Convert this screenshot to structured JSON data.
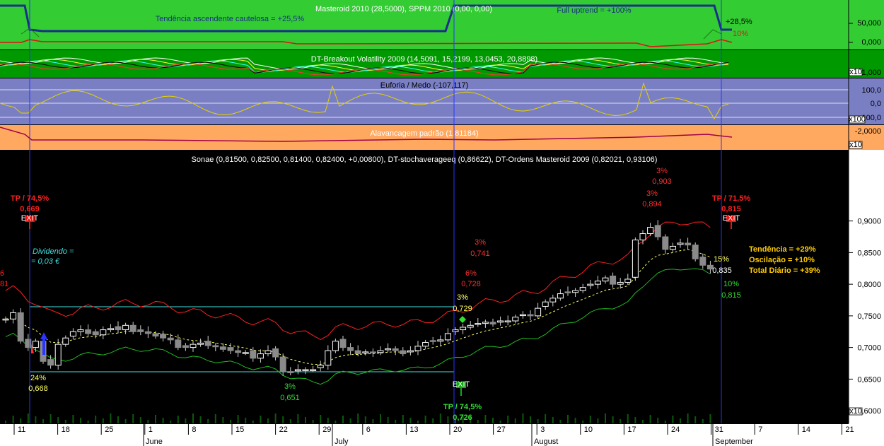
{
  "panels": {
    "p1": {
      "title": "Masteroid 2010 (28,5000), SPPM 2010 (0,00, 0,00)",
      "left_note": "Tendência ascendente cautelosa = +25,5%",
      "right_note": "Full uptrend = +100%",
      "end_label_1": "+28,5%",
      "end_label_2": "10%",
      "ticks": [
        "50,000",
        "0,000"
      ],
      "colors": {
        "bg": "#33cc33",
        "main": "#1a2e8a",
        "red": "#e01010"
      }
    },
    "p2": {
      "title": "DT-Breakout Volatility 2009 (14,5091, 15,2199, 13,0453, 20,8898)",
      "ticks": [
        "1,000"
      ],
      "scale_tag": "x10",
      "colors": {
        "bg": "#009900"
      }
    },
    "p3": {
      "title": "Euforia / Medo (-107,117)",
      "ticks": [
        "100,0",
        "0,0",
        "-100,0"
      ],
      "scale_tag": "x100",
      "colors": {
        "bg": "#7a7fc4",
        "line": "#e6d200"
      }
    },
    "p4": {
      "title": "Alavancagem padrão (1,81184)",
      "ticks": [
        "-2,0000"
      ],
      "scale_tag": "x10",
      "colors": {
        "bg": "#ffa860",
        "line": "#a0004a"
      }
    }
  },
  "main_title": "Sonae (0,81500, 0,82500, 0,81400, 0,82400, +0,00800), DT-stochaverageeq (0,86622), DT-Ordens Masteroid 2009 (0,82021, 0,93106)",
  "annotations": {
    "tp_left": "TP / 74,5%",
    "tp_left_val": "0,669",
    "exit_tag": "EXIT",
    "dividend_1": "Dividendo =",
    "dividend_2": "= 0,03 €",
    "low_pct": "24%",
    "low_val": "0,668",
    "mid_pct": "3%",
    "mid_val": "0,651",
    "tp_mid": "TP / 74,5%",
    "tp_mid_val": "0,726",
    "pct_3_a": "3%",
    "val_0729": "0,729",
    "pct_6": "6%",
    "val_0728": "0,728",
    "pct_3_b": "3%",
    "val_0741": "0,741",
    "pct_3_c": "3%",
    "val_0903": "0,903",
    "pct_3_d": "3%",
    "val_0894": "0,894",
    "tp_right": "TP / 71,5%",
    "tp_right_val": "0,815",
    "pct_15": "15%",
    "val_0835": "0,835",
    "pct_10": "10%",
    "val_0815": "0,815",
    "trend": "Tendência = +29%",
    "osc": "Oscilação = +10%",
    "total": "Total Diário = +39%",
    "left_edge_1": "6",
    "left_edge_2": "81"
  },
  "price_axis": {
    "ticks": [
      "0,9000",
      "0,8500",
      "0,8000",
      "0,7500",
      "0,7000",
      "0,6500",
      "0,6000"
    ],
    "scale_tag": "x10"
  },
  "date_axis": {
    "days": [
      "11",
      "18",
      "25",
      "1",
      "8",
      "15",
      "22",
      "29",
      "6",
      "13",
      "20",
      "27",
      "3",
      "10",
      "17",
      "24",
      "31",
      "7",
      "14",
      "21"
    ],
    "months": [
      "June",
      "July",
      "August",
      "September"
    ]
  },
  "chart_data": {
    "type": "candlestick",
    "title": "Sonae (0,81500, 0,82500, 0,81400, 0,82400, +0,00800)",
    "ylim": [
      0.58,
      0.97
    ],
    "x_labels_days": [
      "11",
      "18",
      "25",
      "1",
      "8",
      "15",
      "22",
      "29",
      "6",
      "13",
      "20",
      "27",
      "3",
      "10",
      "17",
      "24",
      "31",
      "7",
      "14",
      "21"
    ],
    "close": [
      0.745,
      0.755,
      0.71,
      0.7,
      0.71,
      0.678,
      0.672,
      0.705,
      0.715,
      0.725,
      0.728,
      0.722,
      0.72,
      0.728,
      0.73,
      0.728,
      0.735,
      0.725,
      0.725,
      0.722,
      0.718,
      0.715,
      0.712,
      0.7,
      0.7,
      0.705,
      0.707,
      0.703,
      0.701,
      0.697,
      0.695,
      0.692,
      0.692,
      0.683,
      0.69,
      0.695,
      0.685,
      0.662,
      0.66,
      0.665,
      0.665,
      0.665,
      0.672,
      0.695,
      0.71,
      0.7,
      0.695,
      0.69,
      0.693,
      0.692,
      0.695,
      0.698,
      0.695,
      0.69,
      0.695,
      0.702,
      0.708,
      0.71,
      0.712,
      0.722,
      0.728,
      0.732,
      0.735,
      0.738,
      0.74,
      0.737,
      0.742,
      0.742,
      0.748,
      0.752,
      0.75,
      0.762,
      0.772,
      0.778,
      0.785,
      0.787,
      0.79,
      0.795,
      0.8,
      0.805,
      0.81,
      0.8,
      0.803,
      0.808,
      0.87,
      0.88,
      0.89,
      0.875,
      0.855,
      0.86,
      0.865,
      0.862,
      0.84,
      0.83,
      0.824
    ]
  }
}
